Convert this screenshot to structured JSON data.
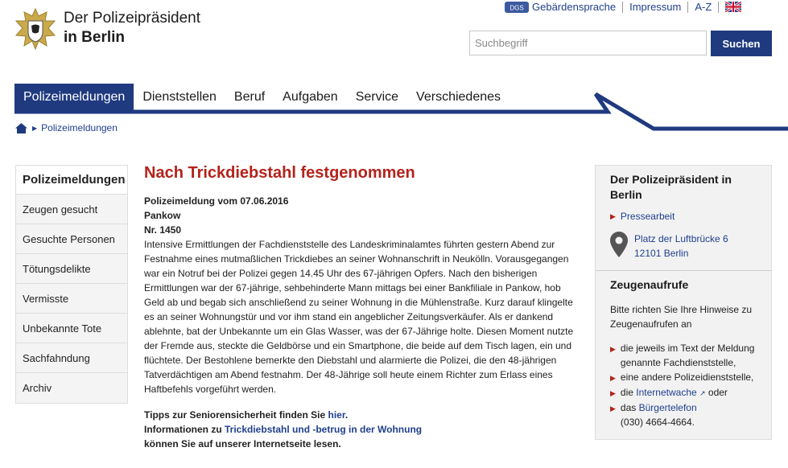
{
  "brand": {
    "line1": "Der Polizeipräsident",
    "line2": "in Berlin"
  },
  "toplinks": {
    "sign_language": "Gebärdensprache",
    "imprint": "Impressum",
    "az": "A-Z"
  },
  "search": {
    "placeholder": "Suchbegriff",
    "button": "Suchen"
  },
  "nav": [
    "Polizeimeldungen",
    "Dienststellen",
    "Beruf",
    "Aufgaben",
    "Service",
    "Verschiedenes"
  ],
  "breadcrumb": "Polizeimeldungen",
  "sidebar": {
    "title": "Polizeimeldungen",
    "items": [
      "Zeugen gesucht",
      "Gesuchte Personen",
      "Tötungsdelikte",
      "Vermisste",
      "Unbekannte Tote",
      "Sachfahndung",
      "Archiv"
    ]
  },
  "article": {
    "title": "Nach Trickdiebstahl festgenommen",
    "date": "Polizeimeldung vom 07.06.2016",
    "district": "Pankow",
    "number": "Nr. 1450",
    "body": "Intensive Ermittlungen der Fachdienststelle des Landeskriminalamtes führten gestern Abend zur Festnahme eines mutmaßlichen Trickdiebes an seiner Wohnanschrift in Neukölln. Vorausgegangen war ein Notruf bei der Polizei gegen 14.45 Uhr des 67-jährigen Opfers. Nach den bisherigen Ermittlungen war der 67-jährige, sehbehinderte Mann mittags bei einer Bankfiliale in Pankow, hob Geld ab und begab sich anschließend zu seiner Wohnung in die Mühlenstraße. Kurz darauf klingelte es an seiner Wohnungstür und vor ihm stand ein angeblicher Zeitungsverkäufer. Als er dankend ablehnte, bat der Unbekannte um ein Glas Wasser, was der 67-Jährige holte. Diesen Moment nutzte der Fremde aus, steckte die Geldbörse und ein Smartphone, die beide auf dem Tisch lagen, ein und flüchtete. Der Bestohlene bemerkte den Diebstahl und alarmierte die Polizei, die den 48-jährigen Tatverdächtigen am Abend festnahm. Der 48-Jährige soll heute einem Richter zum Erlass eines Haftbefehls vorgeführt werden.",
    "tips1_text": "Tipps zur Seniorensicherheit finden Sie ",
    "tips1_link": "hier",
    "tips1_end": ".",
    "tips2_text": "Informationen zu ",
    "tips2_link": "Trickdiebstahl und -betrug in der Wohnung",
    "tips3_text": "können Sie auf unserer Internetseite lesen."
  },
  "right": {
    "box1_title": "Der Polizeipräsident in Berlin",
    "press_link": "Pressearbeit",
    "address_line1": "Platz der Luftbrücke 6",
    "address_line2": "12101 Berlin",
    "box2_title": "Zeugenaufrufe",
    "box2_intro": "Bitte richten Sie Ihre Hinweise zu Zeugenaufrufen an",
    "list1": "die jeweils im Text der Meldung genannte Fachdienststelle,",
    "list2": "eine andere Polizeidienststelle,",
    "list3_pre": "die ",
    "list3_link": "Internetwache",
    "list3_post": " oder",
    "list4_pre": "das ",
    "list4_link": "Bürgertelefon",
    "list4_post": "(030) 4664-4664."
  },
  "colors": {
    "brand_blue": "#1f3a7f",
    "title_red": "#b3231b",
    "link_blue": "#1f3f8c"
  }
}
